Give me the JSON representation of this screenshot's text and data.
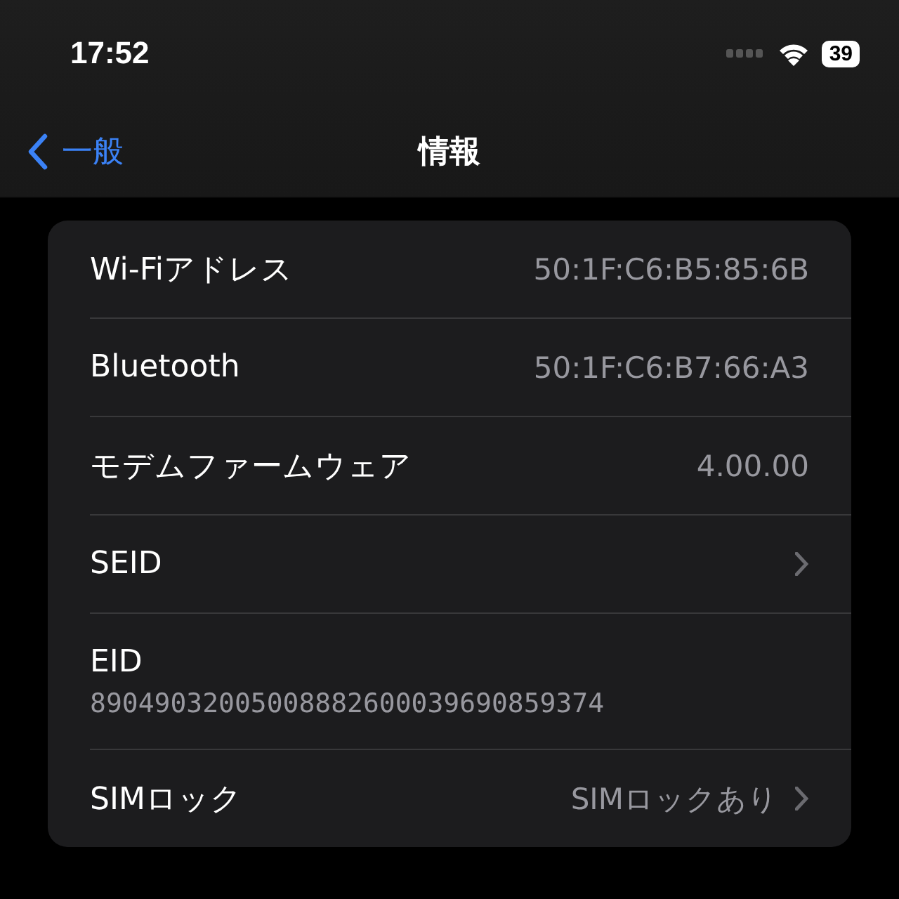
{
  "status_bar": {
    "time": "17:52",
    "battery": "39"
  },
  "nav": {
    "back": "一般",
    "title": "情報"
  },
  "rows": [
    {
      "kind": "value",
      "label": "Wi-Fiアドレス",
      "value": "50:1F:C6:B5:85:6B"
    },
    {
      "kind": "value",
      "label": "Bluetooth",
      "value": "50:1F:C6:B7:66:A3"
    },
    {
      "kind": "value",
      "label": "モデムファームウェア",
      "value": "4.00.00"
    },
    {
      "kind": "link",
      "label": "SEID"
    },
    {
      "kind": "stacked",
      "label": "EID",
      "value": "89049032005008882600039690859374"
    },
    {
      "kind": "link",
      "label": "SIMロック",
      "value": "SIMロックあり"
    }
  ]
}
